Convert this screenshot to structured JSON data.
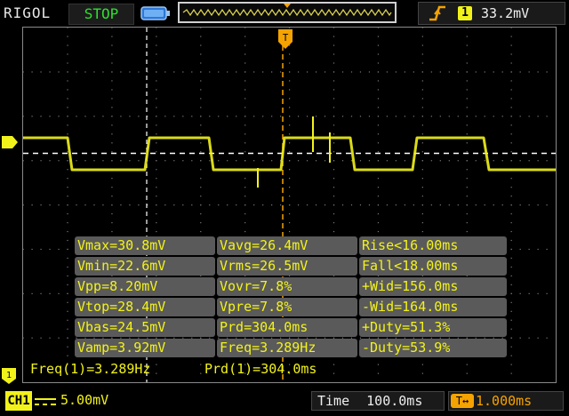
{
  "topbar": {
    "brand": "RIGOL",
    "run_status": "STOP",
    "trigger": {
      "edge_icon": "rising-edge-icon",
      "source": "1",
      "level": "33.2mV"
    }
  },
  "channel": {
    "tag": "CH1",
    "coupling_icon": "dc-coupling-icon",
    "scale": "5.00mV"
  },
  "time": {
    "label": "Time",
    "value": "100.0ms"
  },
  "delay": {
    "icon_label": "T↔",
    "value": "1.000ms"
  },
  "measurements": [
    [
      "Vmax=30.8mV",
      "Vavg=26.4mV",
      "Rise<16.00ms"
    ],
    [
      "Vmin=22.6mV",
      "Vrms=26.5mV",
      "Fall<18.00ms"
    ],
    [
      "Vpp=8.20mV",
      "Vovr=7.8%",
      "+Wid=156.0ms"
    ],
    [
      "Vtop=28.4mV",
      "Vpre=7.8%",
      "-Wid=164.0ms"
    ],
    [
      "Vbas=24.5mV",
      "Prd=304.0ms",
      "+Duty=51.3%"
    ],
    [
      "Vamp=3.92mV",
      "Freq=3.289Hz",
      "-Duty=53.9%"
    ]
  ],
  "readouts": {
    "freq": "Freq(1)=3.289Hz",
    "prd": "Prd(1)=304.0ms"
  },
  "markers": {
    "channel_marker_label": "1",
    "trigger_marker_label": "T"
  },
  "colors": {
    "trace": "#f2f21b",
    "trigger": "#f5a300",
    "run_status": "#2fe02f",
    "measure_bg": "#5a5a5a"
  }
}
